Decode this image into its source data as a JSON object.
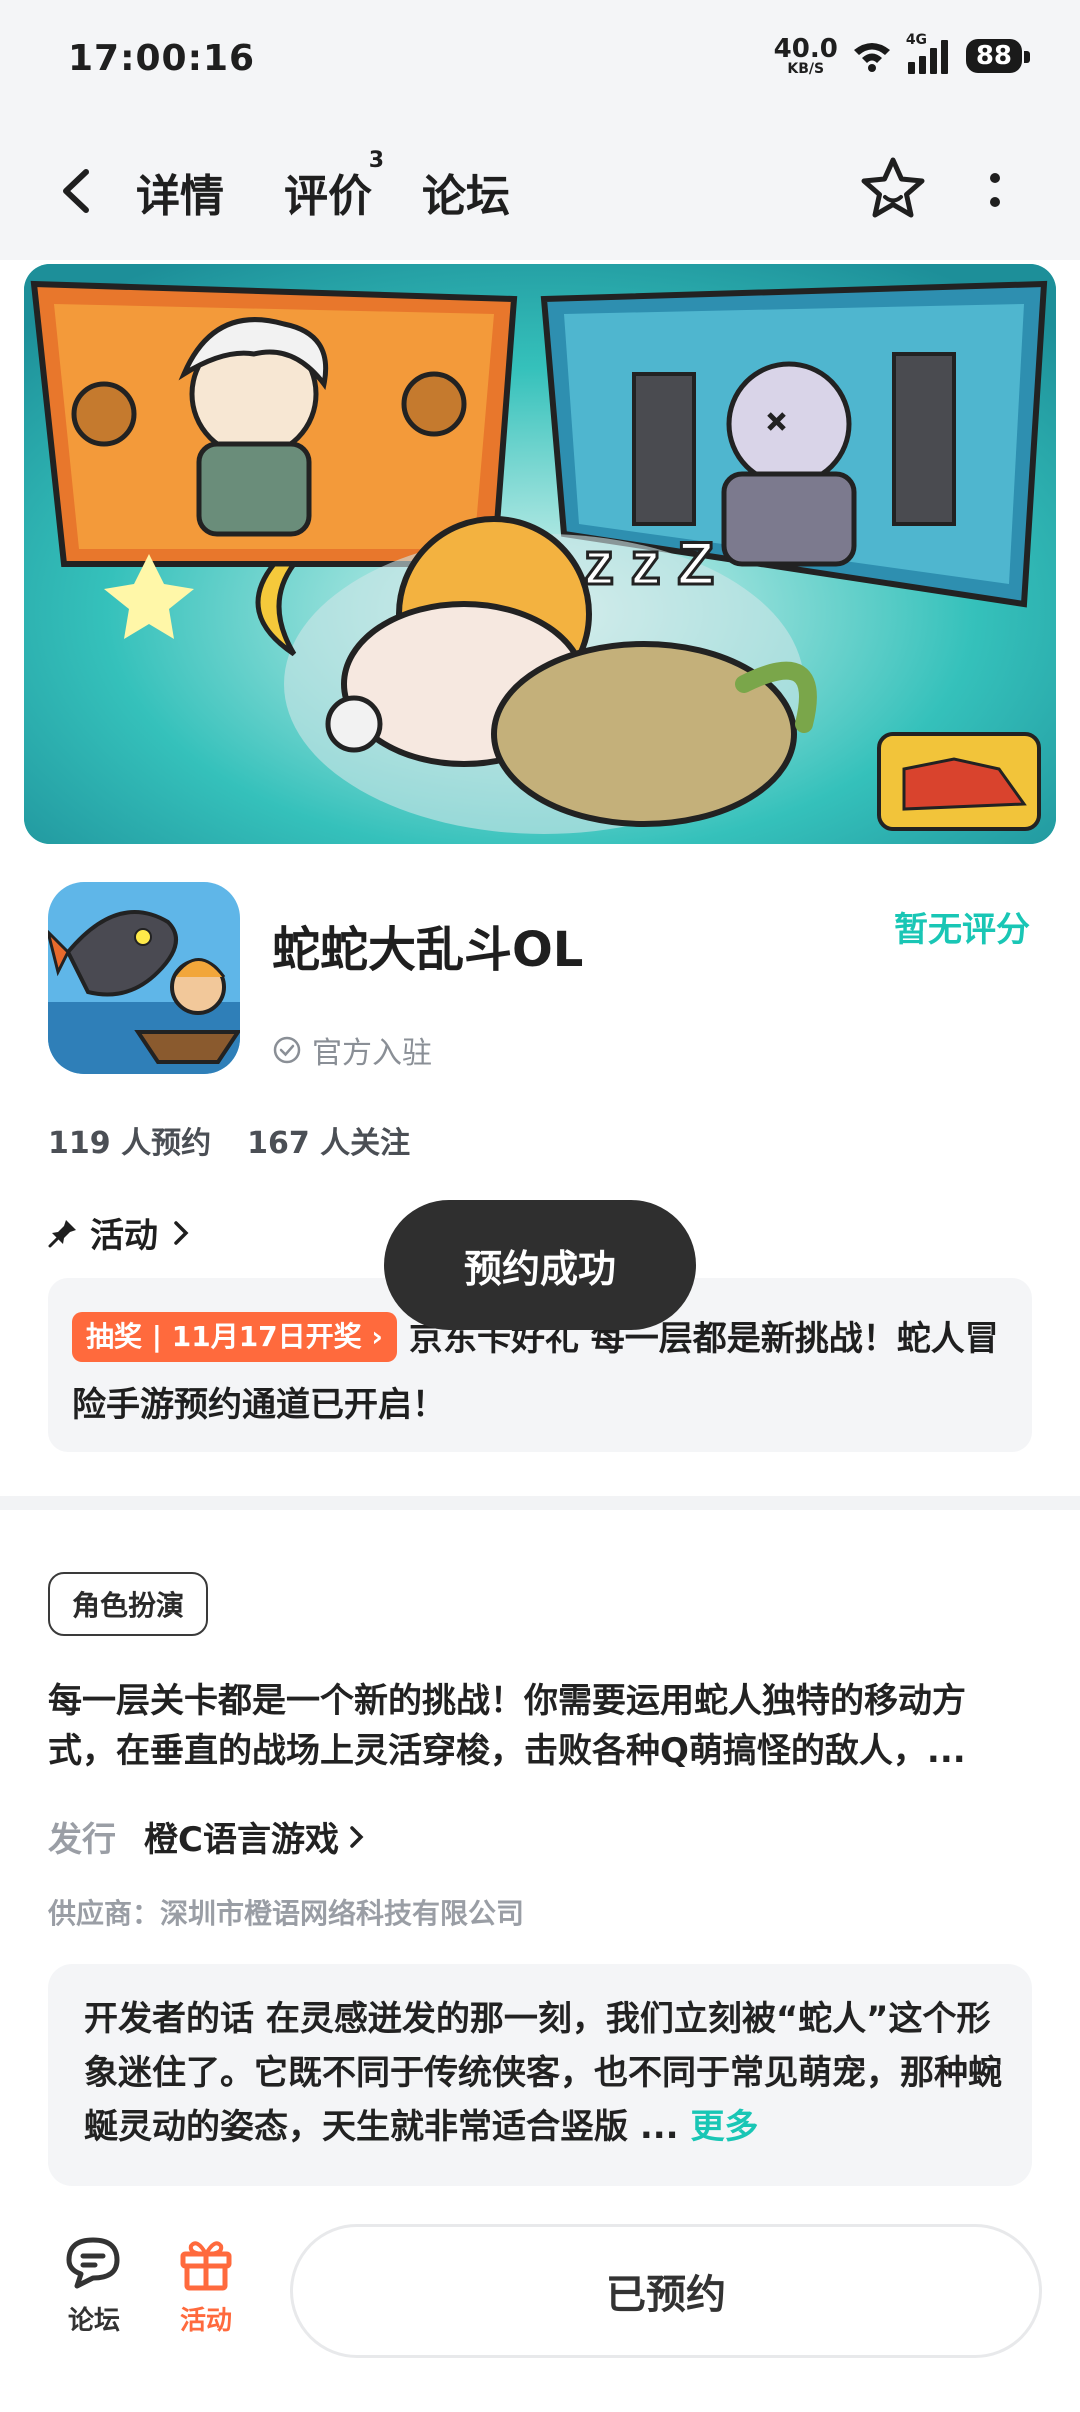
{
  "status_bar": {
    "time": "17:00:16",
    "net_speed_value": "40.0",
    "net_speed_unit": "KB/S",
    "network_type": "4G",
    "battery": "88"
  },
  "nav": {
    "tabs": [
      {
        "label": "详情"
      },
      {
        "label": "评价",
        "badge": "3"
      },
      {
        "label": "论坛"
      }
    ]
  },
  "app": {
    "title": "蛇蛇大乱斗OL",
    "rating": "暂无评分",
    "official_label": "官方入驻",
    "reservations": "119 人预约",
    "followers": "167 人关注"
  },
  "activity": {
    "heading": "活动",
    "badge": "抽奖 | 11月17日开奖",
    "text": "京东卡好礼 每一层都是新挑战！蛇人冒险手游预约通道已开启！"
  },
  "toast": {
    "message": "预约成功"
  },
  "details": {
    "genre": "角色扮演",
    "description": "每一层关卡都是一个新的挑战！你需要运用蛇人独特的移动方式，在垂直的战场上灵活穿梭，击败各种Q萌搞怪的敌人，...",
    "publisher_label": "发行",
    "publisher_name": "橙C语言游戏",
    "supplier": "供应商：深圳市橙语网络科技有限公司"
  },
  "developer_note": {
    "text": "开发者的话  在灵感迸发的那一刻，我们立刻被“蛇人”这个形象迷住了。它既不同于传统侠客，也不同于常见萌宠，那种蜿蜒灵动的姿态，天生就非常适合竖版 ...",
    "more": "更多"
  },
  "bottom_bar": {
    "forum_label": "论坛",
    "activity_label": "活动",
    "action_label": "已预约"
  },
  "colors": {
    "accent": "#19c6b5",
    "orange": "#ff6a3d",
    "toast_bg": "#2f2f2f"
  }
}
